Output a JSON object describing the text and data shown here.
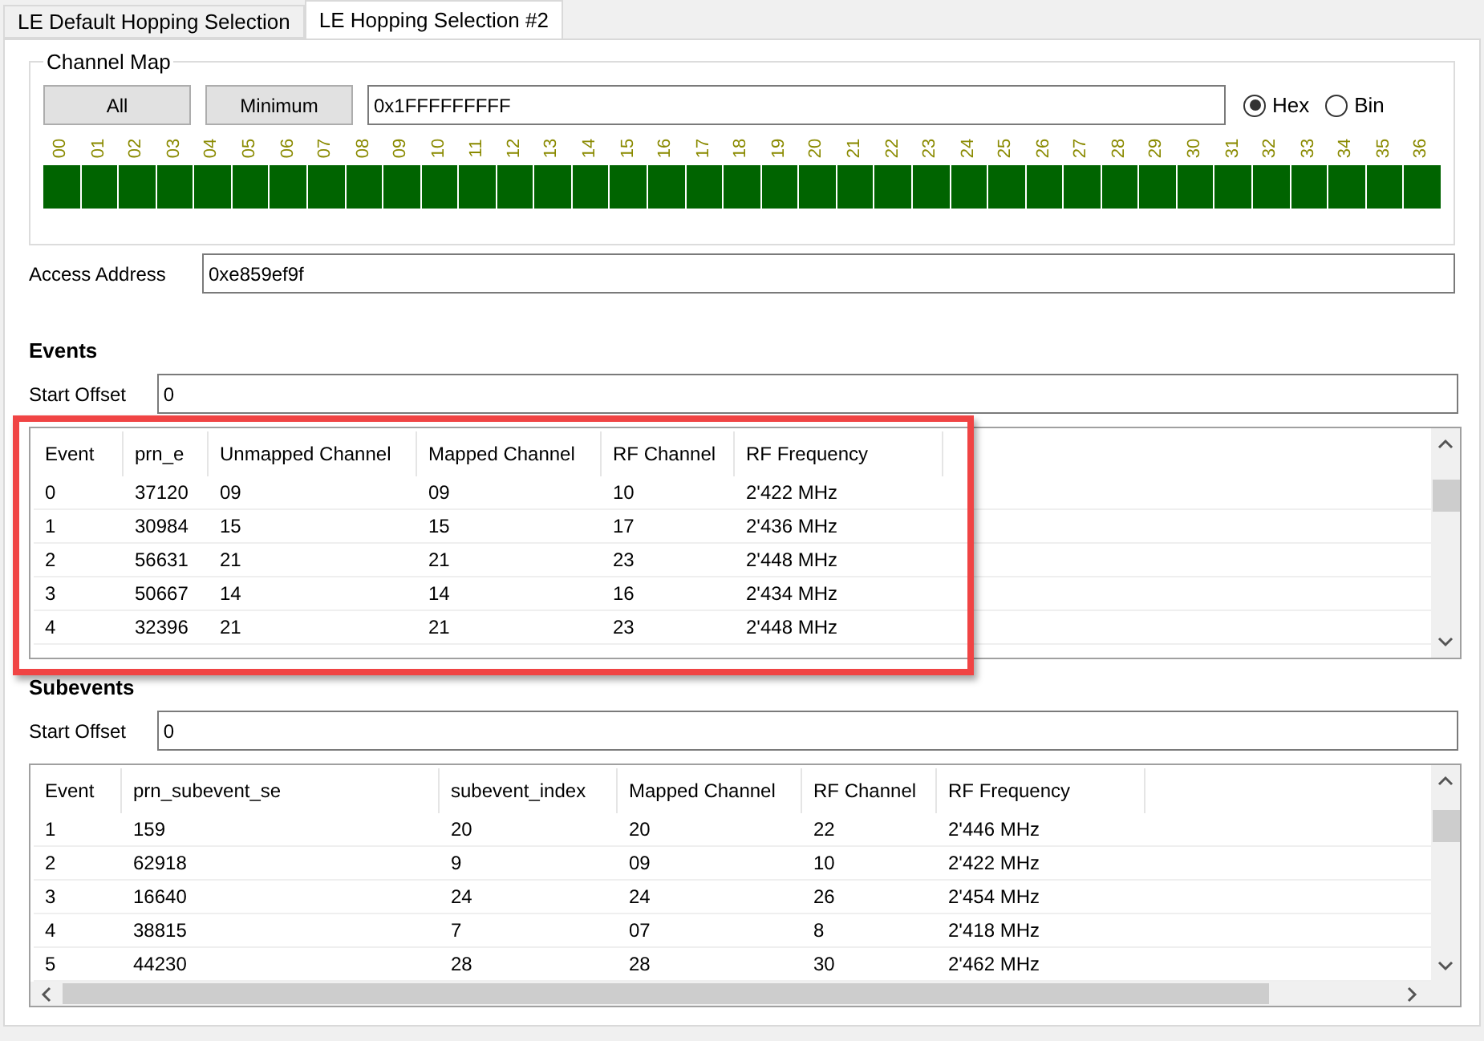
{
  "tabs": [
    {
      "label": "LE Default Hopping Selection",
      "selected": false
    },
    {
      "label": "LE Hopping Selection #2",
      "selected": true
    }
  ],
  "channel_map": {
    "title": "Channel Map",
    "buttons": [
      "All",
      "Minimum"
    ],
    "value": "0x1FFFFFFFFF",
    "format_options": [
      {
        "label": "Hex",
        "selected": true
      },
      {
        "label": "Bin",
        "selected": false
      }
    ],
    "channels": [
      {
        "label": "00",
        "on": true
      },
      {
        "label": "01",
        "on": true
      },
      {
        "label": "02",
        "on": true
      },
      {
        "label": "03",
        "on": true
      },
      {
        "label": "04",
        "on": true
      },
      {
        "label": "05",
        "on": true
      },
      {
        "label": "06",
        "on": true
      },
      {
        "label": "07",
        "on": true
      },
      {
        "label": "08",
        "on": true
      },
      {
        "label": "09",
        "on": true
      },
      {
        "label": "10",
        "on": true
      },
      {
        "label": "11",
        "on": true
      },
      {
        "label": "12",
        "on": true
      },
      {
        "label": "13",
        "on": true
      },
      {
        "label": "14",
        "on": true
      },
      {
        "label": "15",
        "on": true
      },
      {
        "label": "16",
        "on": true
      },
      {
        "label": "17",
        "on": true
      },
      {
        "label": "18",
        "on": true
      },
      {
        "label": "19",
        "on": true
      },
      {
        "label": "20",
        "on": true
      },
      {
        "label": "21",
        "on": true
      },
      {
        "label": "22",
        "on": true
      },
      {
        "label": "23",
        "on": true
      },
      {
        "label": "24",
        "on": true
      },
      {
        "label": "25",
        "on": true
      },
      {
        "label": "26",
        "on": true
      },
      {
        "label": "27",
        "on": true
      },
      {
        "label": "28",
        "on": true
      },
      {
        "label": "29",
        "on": true
      },
      {
        "label": "30",
        "on": true
      },
      {
        "label": "31",
        "on": true
      },
      {
        "label": "32",
        "on": true
      },
      {
        "label": "33",
        "on": true
      },
      {
        "label": "34",
        "on": true
      },
      {
        "label": "35",
        "on": true
      },
      {
        "label": "36",
        "on": true
      }
    ]
  },
  "access_address": {
    "label": "Access Address",
    "value": "0xe859ef9f"
  },
  "events": {
    "title": "Events",
    "start_offset": {
      "label": "Start Offset",
      "value": "0"
    },
    "columns": [
      "Event",
      "prn_e",
      "Unmapped Channel",
      "Mapped Channel",
      "RF Channel",
      "RF Frequency"
    ],
    "rows": [
      [
        "0",
        "37120",
        "09",
        "09",
        "10",
        "2'422 MHz"
      ],
      [
        "1",
        "30984",
        "15",
        "15",
        "17",
        "2'436 MHz"
      ],
      [
        "2",
        "56631",
        "21",
        "21",
        "23",
        "2'448 MHz"
      ],
      [
        "3",
        "50667",
        "14",
        "14",
        "16",
        "2'434 MHz"
      ],
      [
        "4",
        "32396",
        "21",
        "21",
        "23",
        "2'448 MHz"
      ]
    ]
  },
  "subevents": {
    "title": "Subevents",
    "start_offset": {
      "label": "Start Offset",
      "value": "0"
    },
    "columns": [
      "Event",
      "prn_subevent_se",
      "subevent_index",
      "Mapped Channel",
      "RF Channel",
      "RF Frequency"
    ],
    "rows": [
      [
        "1",
        "159",
        "20",
        "20",
        "22",
        "2'446 MHz"
      ],
      [
        "2",
        "62918",
        "9",
        "09",
        "10",
        "2'422 MHz"
      ],
      [
        "3",
        "16640",
        "24",
        "24",
        "26",
        "2'454 MHz"
      ],
      [
        "4",
        "38815",
        "7",
        "07",
        "8",
        "2'418 MHz"
      ],
      [
        "5",
        "44230",
        "28",
        "28",
        "30",
        "2'462 MHz"
      ]
    ]
  }
}
